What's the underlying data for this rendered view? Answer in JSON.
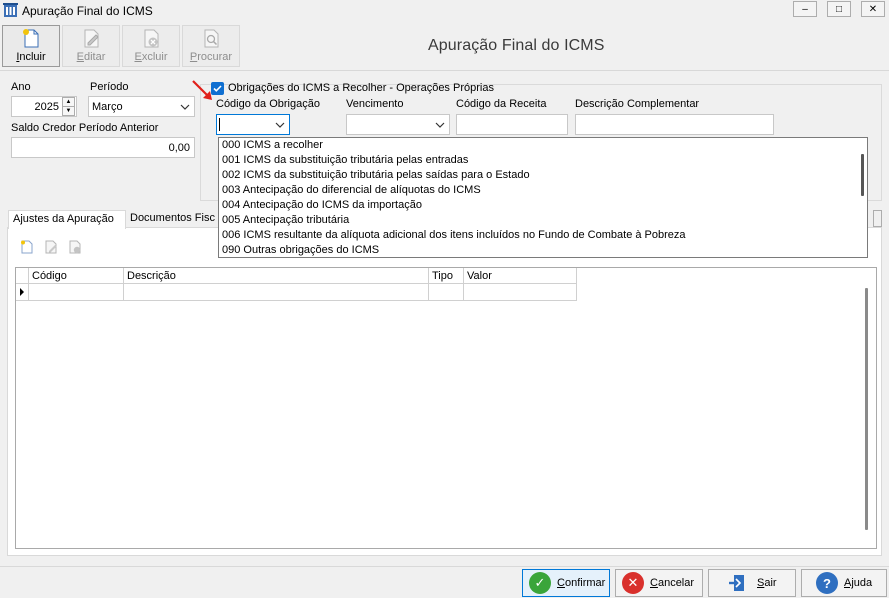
{
  "window": {
    "title": "Apuração Final do ICMS",
    "minimize_glyph": "–",
    "maximize_glyph": "□",
    "close_glyph": "✕"
  },
  "toolbar": {
    "heading": "Apuração Final do ICMS",
    "buttons": [
      {
        "label_first": "I",
        "label_rest": "ncluir",
        "icon": "new-document-icon",
        "enabled": true
      },
      {
        "label_first": "E",
        "label_rest": "ditar",
        "icon": "edit-icon",
        "enabled": false
      },
      {
        "label_first": "E",
        "label_rest": "xcluir",
        "icon": "delete-document-icon",
        "enabled": false
      },
      {
        "label_first": "P",
        "label_rest": "rocurar",
        "icon": "search-document-icon",
        "enabled": false
      }
    ]
  },
  "header": {
    "ano_label": "Ano",
    "ano_value": "2025",
    "periodo_label": "Período",
    "periodo_value": "Março",
    "saldo_label": "Saldo Credor Período Anterior",
    "saldo_value": "0,00"
  },
  "obrigacoes": {
    "checkbox_label": "Obrigações do ICMS a Recolher - Operações Próprias",
    "checked": true,
    "col_codigo_obrigacao": "Código da Obrigação",
    "col_vencimento": "Vencimento",
    "col_codigo_receita": "Código da Receita",
    "col_descricao": "Descrição Complementar",
    "codigo_obrigacao_value": "",
    "vencimento_value": "",
    "codigo_receita_value": "",
    "descricao_value": "",
    "annotation_color": "#e0201b"
  },
  "dropdown": {
    "items": [
      "000 ICMS a recolher",
      "001 ICMS da substituição tributária pelas entradas",
      "002 ICMS da substituição tributária pelas saídas para o Estado",
      "003 Antecipação do diferencial de alíquotas do ICMS",
      "004 Antecipação do ICMS da importação",
      "005 Antecipação tributária",
      "006 ICMS resultante da alíquota adicional dos itens incluídos no Fundo de Combate à Pobreza",
      "090 Outras obrigações do ICMS"
    ]
  },
  "tabs": [
    {
      "label": "Ajustes da Apuração",
      "active": true
    },
    {
      "label": "Documentos Fisc",
      "active": false
    }
  ],
  "grid": {
    "columns": [
      "Código",
      "Descrição",
      "Tipo",
      "Valor"
    ],
    "rows": []
  },
  "footer": {
    "buttons": [
      {
        "label_first": "C",
        "label_rest": "onfirmar",
        "icon": "check-circle-icon",
        "color": "#3aa53a"
      },
      {
        "label_first": "C",
        "label_rest": "ancelar",
        "icon": "cancel-circle-icon",
        "color": "#d9302c"
      },
      {
        "label_first": "S",
        "label_rest": "air",
        "icon": "exit-door-icon",
        "color": "#2f6fc0"
      },
      {
        "label_first": "Aj",
        "label_rest": "uda",
        "icon": "help-circle-icon",
        "color": "#2f6fc0"
      }
    ]
  }
}
